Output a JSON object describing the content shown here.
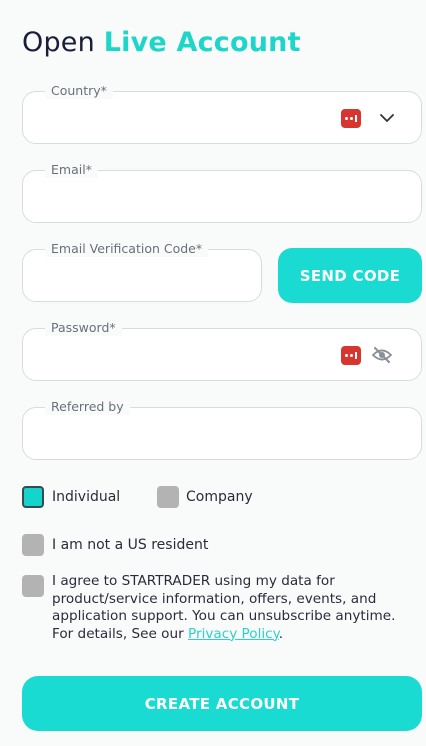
{
  "header": {
    "title_plain": "Open",
    "title_accent": "Live Account"
  },
  "fields": {
    "country": {
      "label": "Country*",
      "value": ""
    },
    "email": {
      "label": "Email*",
      "value": ""
    },
    "verification": {
      "label": "Email Verification Code*",
      "value": ""
    },
    "password": {
      "label": "Password*",
      "value": ""
    },
    "referred": {
      "label": "Referred by",
      "value": ""
    }
  },
  "buttons": {
    "send_code": "SEND CODE",
    "create_account": "CREATE ACCOUNT"
  },
  "account_type": {
    "individual": {
      "label": "Individual",
      "checked": true
    },
    "company": {
      "label": "Company",
      "checked": false
    }
  },
  "us_resident": {
    "label": "I am not a US resident",
    "checked": false
  },
  "consent": {
    "text": "I agree to STARTRADER using my data for product/service information, offers, events, and application support. You can unsubscribe anytime. For details, See our ",
    "link": "Privacy Policy",
    "suffix": ".",
    "checked": false
  },
  "colors": {
    "accent": "#19dbd2",
    "title": "#1b1b3a",
    "password_manager_icon": "#d6362f"
  },
  "icons": [
    "password-manager-icon",
    "chevron-down-icon",
    "eye-off-icon"
  ]
}
